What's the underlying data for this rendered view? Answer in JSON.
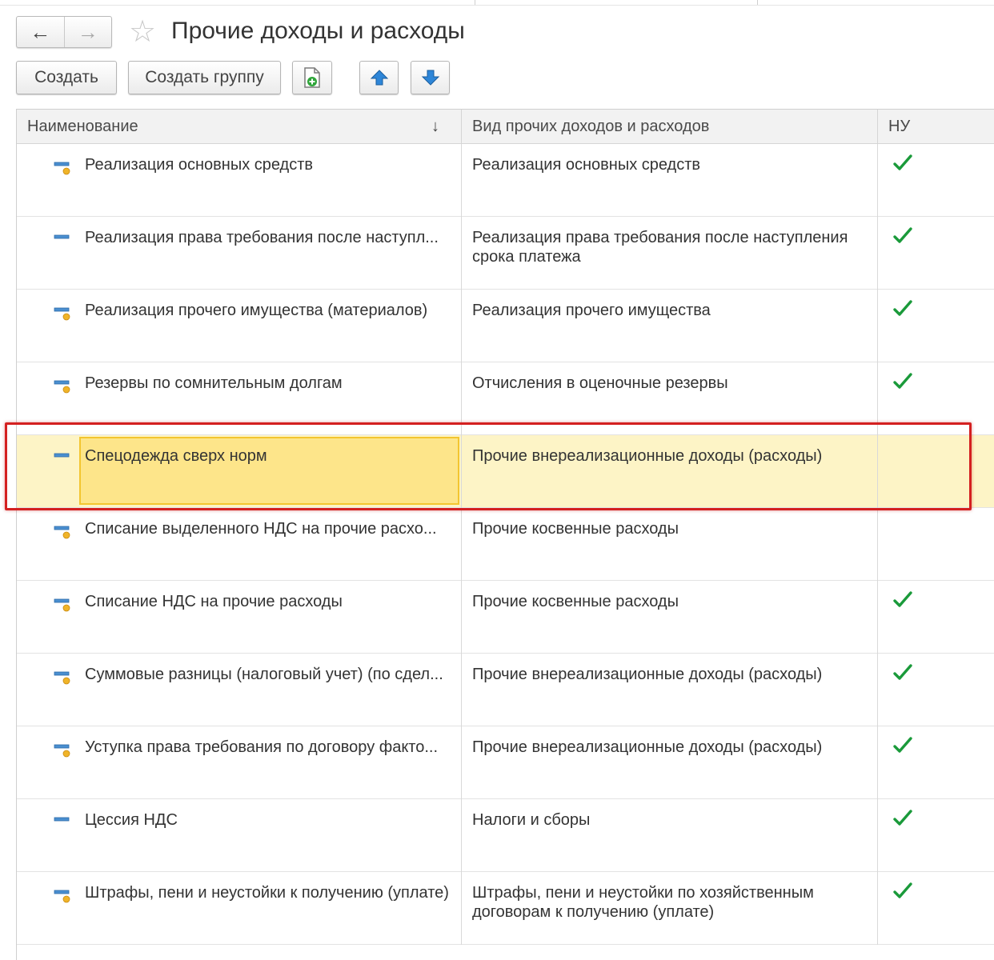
{
  "window": {
    "title": "Прочие доходы и расходы"
  },
  "nav": {
    "back_icon": "arrow-left-icon",
    "forward_icon": "arrow-right-icon",
    "favorite_icon": "star-icon"
  },
  "toolbar": {
    "create_label": "Создать",
    "create_group_label": "Создать группу",
    "copy_icon": "add-copy-icon",
    "move_up_icon": "arrow-up-icon",
    "move_down_icon": "arrow-down-icon"
  },
  "table": {
    "columns": [
      "Наименование",
      "Вид прочих доходов и расходов",
      "НУ"
    ],
    "sort_indicator": "↓",
    "rows": [
      {
        "name": "Реализация основных средств",
        "kind": "Реализация основных средств",
        "nu": true,
        "icon": "item-predefined-icon"
      },
      {
        "name": "Реализация права требования после наступл...",
        "kind": "Реализация права требования после наступления срока платежа",
        "nu": true,
        "icon": "item-icon"
      },
      {
        "name": "Реализация прочего имущества (материалов)",
        "kind": "Реализация прочего имущества",
        "nu": true,
        "icon": "item-predefined-icon"
      },
      {
        "name": "Резервы по сомнительным долгам",
        "kind": "Отчисления в оценочные резервы",
        "nu": true,
        "icon": "item-predefined-icon"
      },
      {
        "name": "Спецодежда сверх норм",
        "kind": "Прочие внереализационные доходы (расходы)",
        "nu": false,
        "icon": "item-icon",
        "selected": true
      },
      {
        "name": "Списание выделенного НДС на прочие расхо...",
        "kind": "Прочие косвенные расходы",
        "nu": false,
        "icon": "item-predefined-icon"
      },
      {
        "name": "Списание НДС на прочие расходы",
        "kind": "Прочие косвенные расходы",
        "nu": true,
        "icon": "item-predefined-icon"
      },
      {
        "name": "Суммовые разницы (налоговый учет) (по сдел...",
        "kind": "Прочие внереализационные доходы (расходы)",
        "nu": true,
        "icon": "item-predefined-icon"
      },
      {
        "name": "Уступка права требования по договору факто...",
        "kind": "Прочие внереализационные доходы (расходы)",
        "nu": true,
        "icon": "item-predefined-icon"
      },
      {
        "name": "Цессия НДС",
        "kind": "Налоги и сборы",
        "nu": true,
        "icon": "item-icon"
      },
      {
        "name": "Штрафы, пени и неустойки к получению (уплате)",
        "kind": "Штрафы, пени и неустойки по хозяйственным договорам к получению (уплате)",
        "nu": true,
        "icon": "item-predefined-icon"
      }
    ]
  },
  "colors": {
    "selected_row": "#fdf4c6",
    "selected_cell": "#fde58a",
    "check": "#1a9a3a",
    "highlight_frame": "#d42020"
  }
}
